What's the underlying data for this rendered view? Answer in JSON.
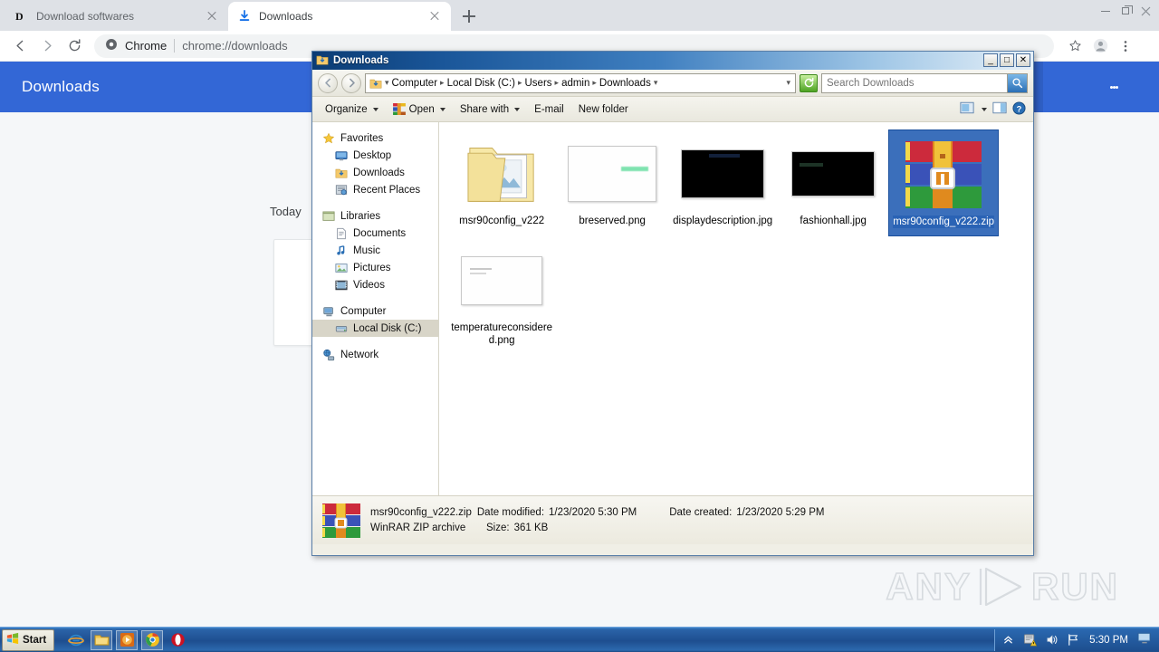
{
  "browser": {
    "tabs": [
      {
        "title": "Download softwares",
        "favicon": "dotnet-icon",
        "active": false
      },
      {
        "title": "Downloads",
        "favicon": "download-icon",
        "active": true
      }
    ],
    "new_tab_label": "+",
    "window_controls": {
      "minimize": "–",
      "maximize": "□",
      "close": "✕"
    },
    "toolbar": {
      "back": "←",
      "forward": "→",
      "reload": "⟳",
      "secure_label": "Chrome",
      "url": "chrome://downloads",
      "bookmark": "☆",
      "profile": "avatar-icon",
      "menu": "⋮"
    }
  },
  "downloads_page": {
    "title": "Downloads",
    "search_icon": "search-icon",
    "menu_icon": "kebab-menu-icon",
    "date_group": "Today",
    "item_icon": "winrar-zip-icon",
    "accent_color": "#3367d6"
  },
  "watermark": {
    "left": "ANY",
    "right": "RUN"
  },
  "explorer": {
    "title": "Downloads",
    "title_icon": "downloads-folder-icon",
    "window_buttons": {
      "minimize": "_",
      "maximize": "□",
      "close": "✕"
    },
    "nav": {
      "back": "←",
      "forward": "→",
      "address_icon": "downloads-folder-icon",
      "breadcrumbs": [
        "Computer",
        "Local Disk (C:)",
        "Users",
        "admin",
        "Downloads"
      ],
      "dropdown": "▾",
      "refresh": "↻",
      "search_placeholder": "Search Downloads",
      "search_value": "",
      "search_icon": "search-icon"
    },
    "toolbar": {
      "items": [
        {
          "label": "Organize",
          "icon": "",
          "caret": true
        },
        {
          "label": "Open",
          "icon": "winrar-icon",
          "caret": true
        },
        {
          "label": "Share with",
          "icon": "",
          "caret": true
        },
        {
          "label": "E-mail",
          "icon": "",
          "caret": false
        },
        {
          "label": "New folder",
          "icon": "",
          "caret": false
        }
      ],
      "right_icons": [
        "preview-pane-icon",
        "view-caret-icon",
        "layout-pane-icon",
        "help-icon"
      ]
    },
    "sidebar": [
      {
        "label": "Favorites",
        "icon": "star-icon",
        "level": 0,
        "selected": false
      },
      {
        "label": "Desktop",
        "icon": "desktop-icon",
        "level": 1,
        "selected": false
      },
      {
        "label": "Downloads",
        "icon": "downloads-folder-icon",
        "level": 1,
        "selected": false
      },
      {
        "label": "Recent Places",
        "icon": "recent-places-icon",
        "level": 1,
        "selected": false
      },
      {
        "label": "Libraries",
        "icon": "libraries-icon",
        "level": 0,
        "selected": false
      },
      {
        "label": "Documents",
        "icon": "documents-icon",
        "level": 1,
        "selected": false
      },
      {
        "label": "Music",
        "icon": "music-icon",
        "level": 1,
        "selected": false
      },
      {
        "label": "Pictures",
        "icon": "pictures-icon",
        "level": 1,
        "selected": false
      },
      {
        "label": "Videos",
        "icon": "videos-icon",
        "level": 1,
        "selected": false
      },
      {
        "label": "Computer",
        "icon": "computer-icon",
        "level": 0,
        "selected": false
      },
      {
        "label": "Local Disk (C:)",
        "icon": "hard-disk-icon",
        "level": 1,
        "selected": true
      },
      {
        "label": "Network",
        "icon": "network-icon",
        "level": 0,
        "selected": false
      }
    ],
    "files": [
      {
        "name": "msr90config_v222",
        "type": "folder",
        "selected": false
      },
      {
        "name": "breserved.png",
        "type": "image-white",
        "selected": false,
        "thumb_text": "breserved"
      },
      {
        "name": "displaydescription.jpg",
        "type": "image-black",
        "selected": false,
        "thumb_text": "displaydescription"
      },
      {
        "name": "fashionhall.jpg",
        "type": "image-black",
        "selected": false,
        "thumb_text": "fashionhall"
      },
      {
        "name": "msr90config_v222.zip",
        "type": "winrar-zip",
        "selected": true
      },
      {
        "name": "temperatureconsidered.png",
        "type": "image-white-lines",
        "selected": false
      }
    ],
    "status": {
      "icon": "winrar-zip-icon",
      "file_name": "msr90config_v222.zip",
      "date_modified_label": "Date modified:",
      "date_modified_value": "1/23/2020 5:30 PM",
      "date_created_label": "Date created:",
      "date_created_value": "1/23/2020 5:29 PM",
      "file_type": "WinRAR ZIP archive",
      "size_label": "Size:",
      "size_value": "361 KB"
    }
  },
  "taskbar": {
    "start_label": "Start",
    "quick_launch": [
      "internet-explorer-icon",
      "windows-explorer-icon",
      "media-player-icon",
      "chrome-icon",
      "opera-icon"
    ],
    "tray": {
      "overflow": "show-hidden-icons-icon",
      "action_center": "action-center-warning-icon",
      "volume": "volume-icon",
      "network": "network-flag-icon",
      "time": "5:30 PM",
      "show_desktop": "show-desktop-icon"
    }
  }
}
